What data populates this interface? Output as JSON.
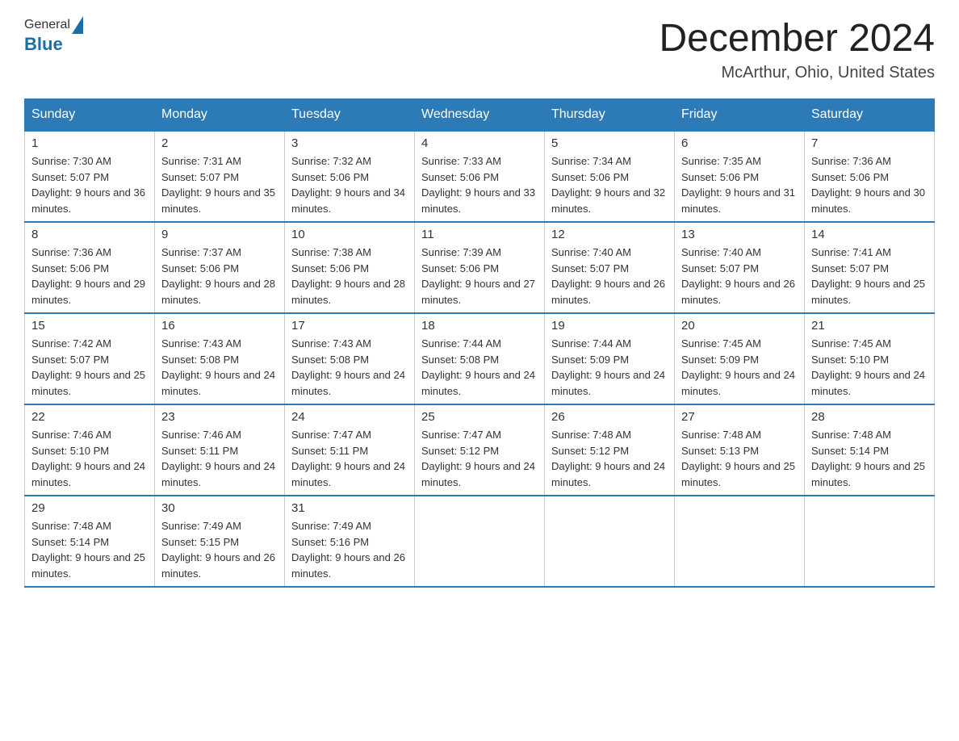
{
  "logo": {
    "general": "General",
    "blue": "Blue"
  },
  "title": {
    "month_year": "December 2024",
    "location": "McArthur, Ohio, United States"
  },
  "days_of_week": [
    "Sunday",
    "Monday",
    "Tuesday",
    "Wednesday",
    "Thursday",
    "Friday",
    "Saturday"
  ],
  "weeks": [
    [
      {
        "day": "1",
        "sunrise": "7:30 AM",
        "sunset": "5:07 PM",
        "daylight": "9 hours and 36 minutes."
      },
      {
        "day": "2",
        "sunrise": "7:31 AM",
        "sunset": "5:07 PM",
        "daylight": "9 hours and 35 minutes."
      },
      {
        "day": "3",
        "sunrise": "7:32 AM",
        "sunset": "5:06 PM",
        "daylight": "9 hours and 34 minutes."
      },
      {
        "day": "4",
        "sunrise": "7:33 AM",
        "sunset": "5:06 PM",
        "daylight": "9 hours and 33 minutes."
      },
      {
        "day": "5",
        "sunrise": "7:34 AM",
        "sunset": "5:06 PM",
        "daylight": "9 hours and 32 minutes."
      },
      {
        "day": "6",
        "sunrise": "7:35 AM",
        "sunset": "5:06 PM",
        "daylight": "9 hours and 31 minutes."
      },
      {
        "day": "7",
        "sunrise": "7:36 AM",
        "sunset": "5:06 PM",
        "daylight": "9 hours and 30 minutes."
      }
    ],
    [
      {
        "day": "8",
        "sunrise": "7:36 AM",
        "sunset": "5:06 PM",
        "daylight": "9 hours and 29 minutes."
      },
      {
        "day": "9",
        "sunrise": "7:37 AM",
        "sunset": "5:06 PM",
        "daylight": "9 hours and 28 minutes."
      },
      {
        "day": "10",
        "sunrise": "7:38 AM",
        "sunset": "5:06 PM",
        "daylight": "9 hours and 28 minutes."
      },
      {
        "day": "11",
        "sunrise": "7:39 AM",
        "sunset": "5:06 PM",
        "daylight": "9 hours and 27 minutes."
      },
      {
        "day": "12",
        "sunrise": "7:40 AM",
        "sunset": "5:07 PM",
        "daylight": "9 hours and 26 minutes."
      },
      {
        "day": "13",
        "sunrise": "7:40 AM",
        "sunset": "5:07 PM",
        "daylight": "9 hours and 26 minutes."
      },
      {
        "day": "14",
        "sunrise": "7:41 AM",
        "sunset": "5:07 PM",
        "daylight": "9 hours and 25 minutes."
      }
    ],
    [
      {
        "day": "15",
        "sunrise": "7:42 AM",
        "sunset": "5:07 PM",
        "daylight": "9 hours and 25 minutes."
      },
      {
        "day": "16",
        "sunrise": "7:43 AM",
        "sunset": "5:08 PM",
        "daylight": "9 hours and 24 minutes."
      },
      {
        "day": "17",
        "sunrise": "7:43 AM",
        "sunset": "5:08 PM",
        "daylight": "9 hours and 24 minutes."
      },
      {
        "day": "18",
        "sunrise": "7:44 AM",
        "sunset": "5:08 PM",
        "daylight": "9 hours and 24 minutes."
      },
      {
        "day": "19",
        "sunrise": "7:44 AM",
        "sunset": "5:09 PM",
        "daylight": "9 hours and 24 minutes."
      },
      {
        "day": "20",
        "sunrise": "7:45 AM",
        "sunset": "5:09 PM",
        "daylight": "9 hours and 24 minutes."
      },
      {
        "day": "21",
        "sunrise": "7:45 AM",
        "sunset": "5:10 PM",
        "daylight": "9 hours and 24 minutes."
      }
    ],
    [
      {
        "day": "22",
        "sunrise": "7:46 AM",
        "sunset": "5:10 PM",
        "daylight": "9 hours and 24 minutes."
      },
      {
        "day": "23",
        "sunrise": "7:46 AM",
        "sunset": "5:11 PM",
        "daylight": "9 hours and 24 minutes."
      },
      {
        "day": "24",
        "sunrise": "7:47 AM",
        "sunset": "5:11 PM",
        "daylight": "9 hours and 24 minutes."
      },
      {
        "day": "25",
        "sunrise": "7:47 AM",
        "sunset": "5:12 PM",
        "daylight": "9 hours and 24 minutes."
      },
      {
        "day": "26",
        "sunrise": "7:48 AM",
        "sunset": "5:12 PM",
        "daylight": "9 hours and 24 minutes."
      },
      {
        "day": "27",
        "sunrise": "7:48 AM",
        "sunset": "5:13 PM",
        "daylight": "9 hours and 25 minutes."
      },
      {
        "day": "28",
        "sunrise": "7:48 AM",
        "sunset": "5:14 PM",
        "daylight": "9 hours and 25 minutes."
      }
    ],
    [
      {
        "day": "29",
        "sunrise": "7:48 AM",
        "sunset": "5:14 PM",
        "daylight": "9 hours and 25 minutes."
      },
      {
        "day": "30",
        "sunrise": "7:49 AM",
        "sunset": "5:15 PM",
        "daylight": "9 hours and 26 minutes."
      },
      {
        "day": "31",
        "sunrise": "7:49 AM",
        "sunset": "5:16 PM",
        "daylight": "9 hours and 26 minutes."
      },
      null,
      null,
      null,
      null
    ]
  ]
}
